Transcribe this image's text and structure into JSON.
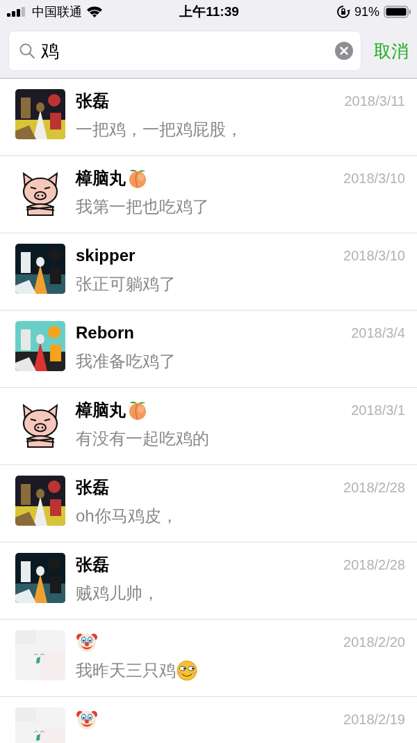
{
  "status_bar": {
    "carrier": "中国联通",
    "time": "上午11:39",
    "battery": "91%"
  },
  "search": {
    "value": "鸡",
    "cancel": "取消"
  },
  "results": [
    {
      "name": "张磊",
      "date": "2018/3/11",
      "preview": "一把鸡，一把鸡屁股，"
    },
    {
      "avatar": {
        "kind": "pig"
      },
      "name": "樟脑丸",
      "name_icon": {
        "kind": "peach"
      },
      "date": "2018/3/10",
      "preview": "我第一把也吃鸡了"
    },
    {
      "name": "skipper",
      "date": "2018/3/10",
      "preview": "张正可躺鸡了"
    },
    {
      "name": "Reborn",
      "date": "2018/3/4",
      "preview": "我准备吃鸡了"
    },
    {
      "avatar": {
        "kind": "pig"
      },
      "name": "樟脑丸",
      "name_icon": {
        "kind": "peach"
      },
      "date": "2018/3/1",
      "preview": "有没有一起吃鸡的"
    },
    {
      "name": "张磊",
      "date": "2018/2/28",
      "preview": "oh你马鸡皮，"
    },
    {
      "name": "张磊",
      "date": "2018/2/28",
      "preview": "贼鸡儿帅，"
    },
    {
      "avatar": {
        "kind": "sticker"
      },
      "name_icon": {
        "kind": "clown"
      },
      "date": "2018/2/20",
      "preview": "我昨天三只鸡",
      "preview_icon": {
        "kind": "smirk"
      }
    },
    {
      "avatar": {
        "kind": "sticker"
      },
      "name_icon": {
        "kind": "clown"
      },
      "date": "2018/2/19"
    }
  ]
}
